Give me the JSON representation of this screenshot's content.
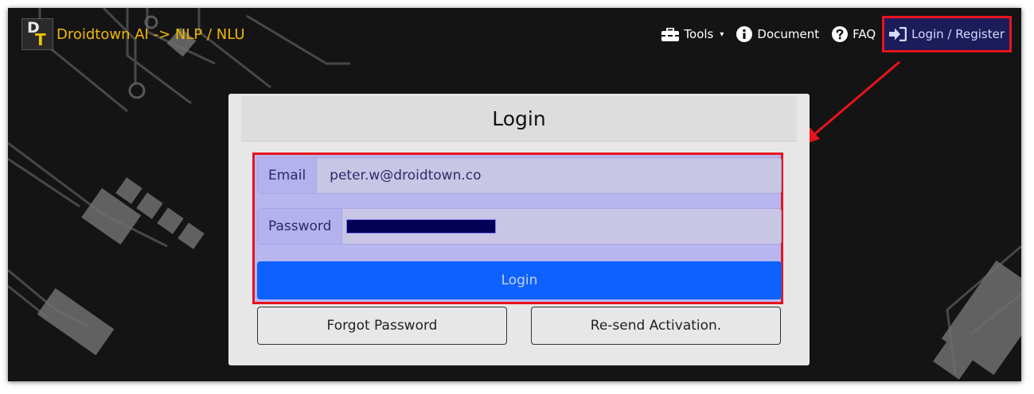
{
  "brand": {
    "logo_letters": [
      "D",
      "T"
    ],
    "title": "Droidtown AI -> NLP / NLU"
  },
  "nav": {
    "tools": {
      "label": "Tools",
      "icon": "toolbox-icon",
      "caret": "▾"
    },
    "document": {
      "label": "Document",
      "icon": "info-circle-icon"
    },
    "faq": {
      "label": "FAQ",
      "icon": "question-circle-icon"
    },
    "login_register": {
      "label": "Login / Register",
      "icon": "sign-in-icon"
    }
  },
  "login_card": {
    "title": "Login",
    "email": {
      "label": "Email",
      "value": "peter.w@droidtown.co"
    },
    "password": {
      "label": "Password",
      "value_masked": true
    },
    "submit_label": "Login",
    "forgot_label": "Forgot Password",
    "resend_label": "Re-send Activation."
  },
  "colors": {
    "brand_text": "#f2b705",
    "highlight_border": "#e8141c",
    "primary_button": "#0d62ff",
    "form_highlight": "#b8b6f0"
  }
}
